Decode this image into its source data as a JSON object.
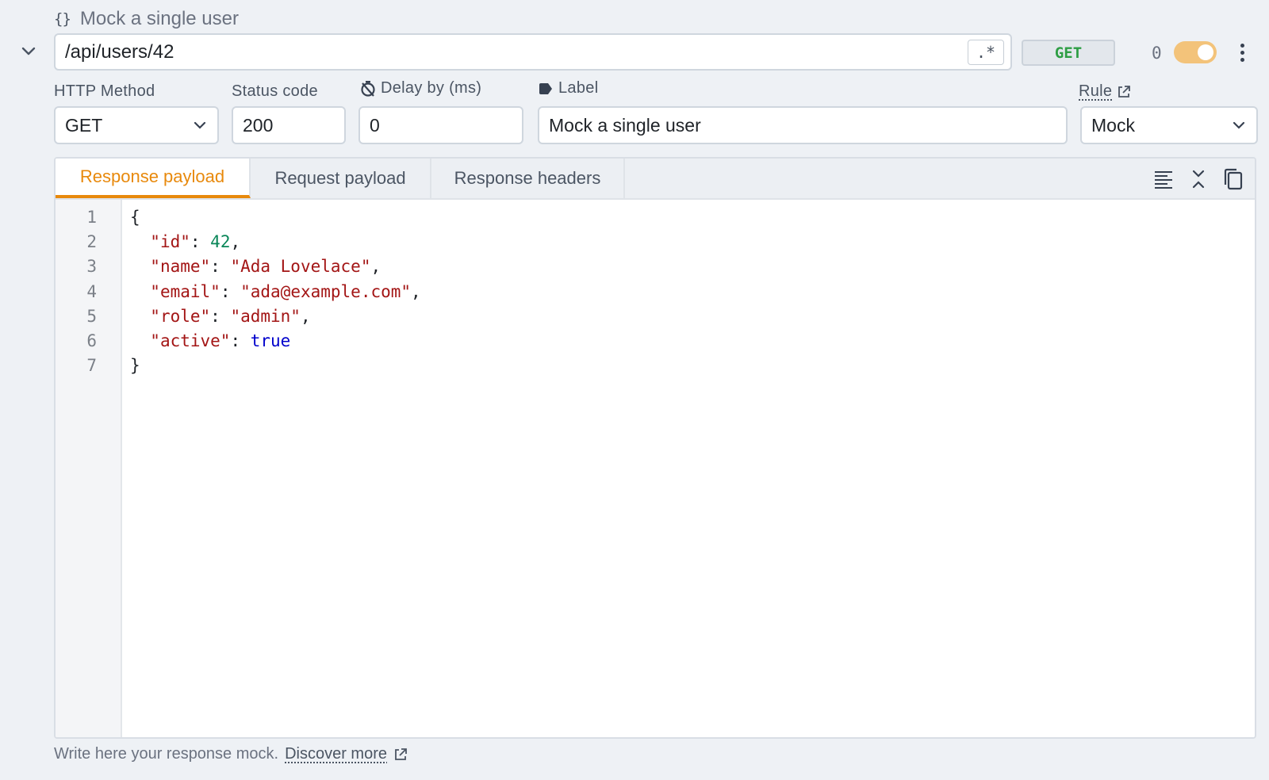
{
  "rule": {
    "title": "Mock a single user",
    "url_pattern": "/api/users/42",
    "regex_label": ".*",
    "method_badge": "GET",
    "hit_count": "0",
    "enabled": true
  },
  "fields": {
    "method": {
      "label": "HTTP Method",
      "value": "GET"
    },
    "status": {
      "label": "Status code",
      "value": "200"
    },
    "delay": {
      "label": "Delay by (ms)",
      "value": "0"
    },
    "label": {
      "label": "Label",
      "value": "Mock a single user"
    },
    "rule": {
      "label": "Rule",
      "value": "Mock"
    }
  },
  "tabs": [
    {
      "label": "Response payload",
      "active": true
    },
    {
      "label": "Request payload",
      "active": false
    },
    {
      "label": "Response headers",
      "active": false
    }
  ],
  "editor": {
    "line_numbers": [
      "1",
      "2",
      "3",
      "4",
      "5",
      "6",
      "7"
    ],
    "lines": {
      "open": "{",
      "id_key": "\"id\"",
      "id_val": "42",
      "name_key": "\"name\"",
      "name_val": "\"Ada Lovelace\"",
      "email_key": "\"email\"",
      "email_val": "\"ada@example.com\"",
      "role_key": "\"role\"",
      "role_val": "\"admin\"",
      "active_key": "\"active\"",
      "active_val": "true",
      "close": "}"
    }
  },
  "footer": {
    "hint": "Write here your response mock.",
    "link": "Discover more"
  },
  "colors": {
    "accent": "#e8890c",
    "method_green": "#2e9e44",
    "toggle_on": "#f3c37a"
  },
  "icons": [
    "braces-icon",
    "chevron-down-icon",
    "timer-off-icon",
    "tag-icon",
    "external-link-icon",
    "format-icon",
    "collapse-icon",
    "copy-icon"
  ]
}
